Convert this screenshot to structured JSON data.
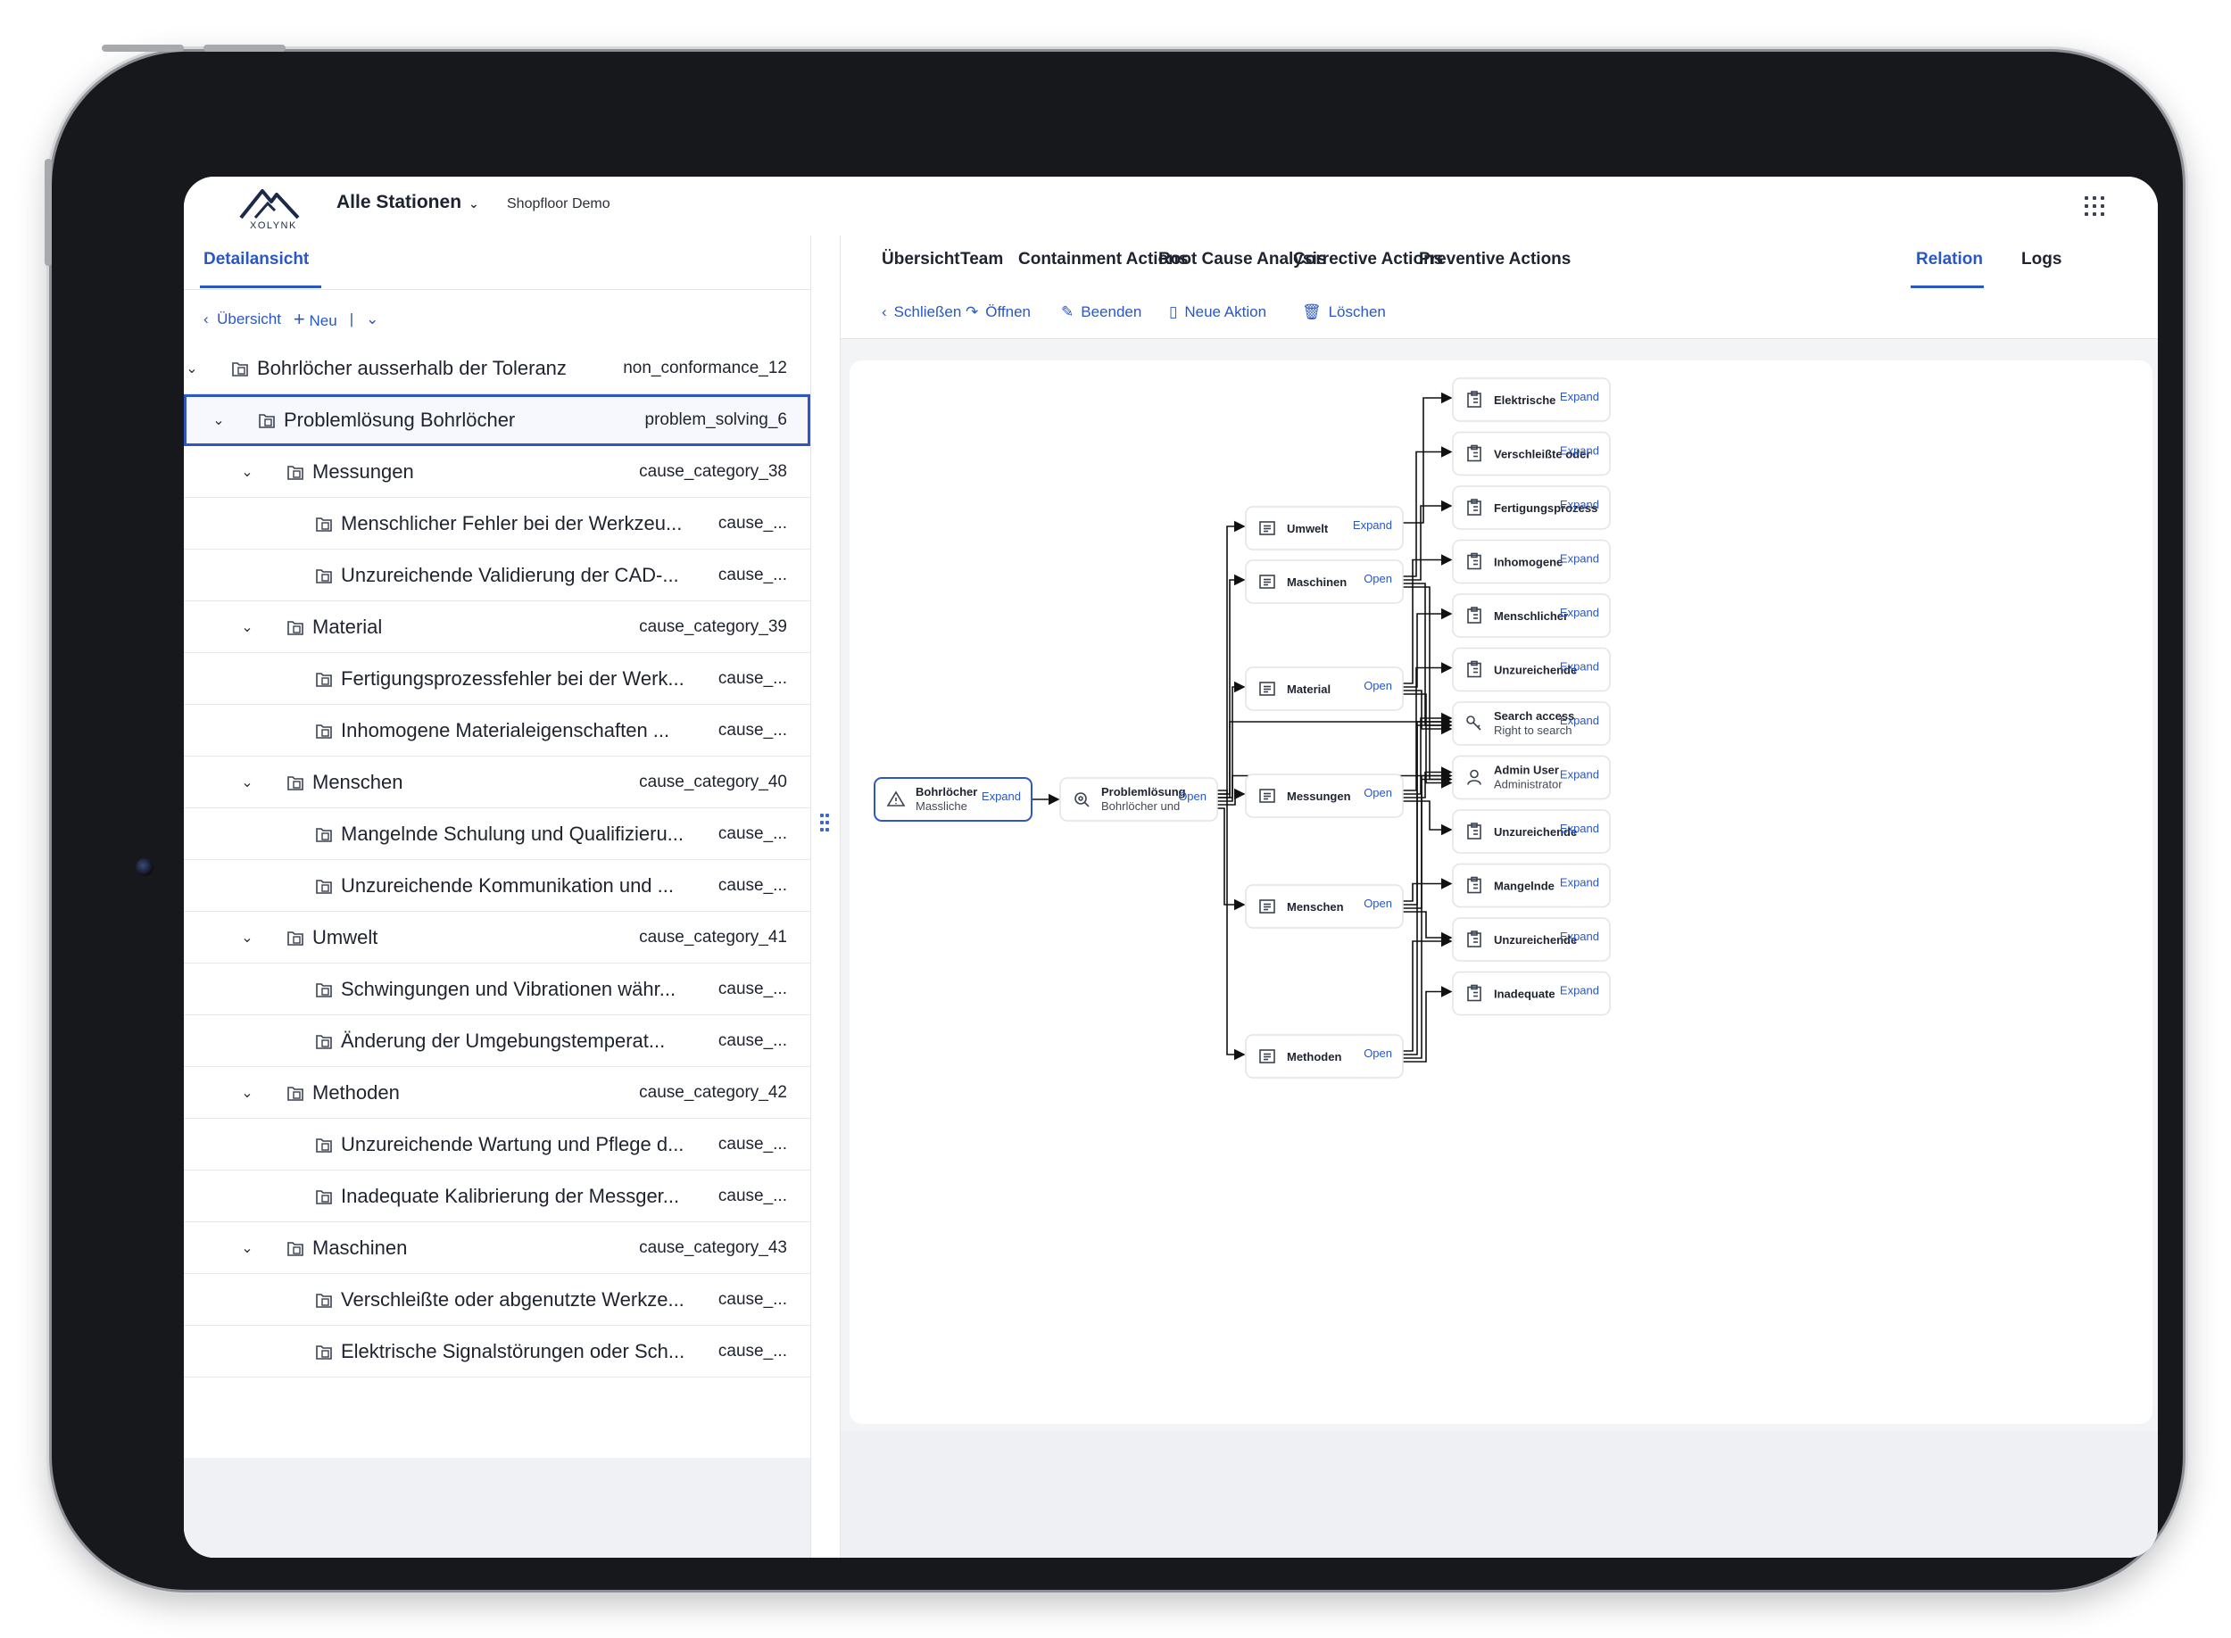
{
  "header": {
    "logo_text": "XOLYNK",
    "station": "Alle Stationen",
    "workspace": "Shopfloor Demo",
    "apps_icon": "grid-icon"
  },
  "left": {
    "tab": "Detailansicht",
    "toolbar": {
      "back": "Übersicht",
      "new": "Neu"
    },
    "tree": [
      {
        "level": 0,
        "expandable": true,
        "name": "Bohrlöcher ausserhalb der Toleranz",
        "id": "non_conformance_12"
      },
      {
        "level": 1,
        "expandable": true,
        "selected": true,
        "name": "Problemlösung Bohrlöcher",
        "id": "problem_solving_6"
      },
      {
        "level": 2,
        "expandable": true,
        "name": "Messungen",
        "id": "cause_category_38"
      },
      {
        "level": 3,
        "expandable": false,
        "name": "Menschlicher Fehler bei der Werkzeu...",
        "id": "cause_..."
      },
      {
        "level": 3,
        "expandable": false,
        "name": "Unzureichende Validierung der CAD-...",
        "id": "cause_..."
      },
      {
        "level": 2,
        "expandable": true,
        "name": "Material",
        "id": "cause_category_39"
      },
      {
        "level": 3,
        "expandable": false,
        "name": "Fertigungsprozessfehler bei der Werk...",
        "id": "cause_..."
      },
      {
        "level": 3,
        "expandable": false,
        "name": "Inhomogene Materialeigenschaften ...",
        "id": "cause_..."
      },
      {
        "level": 2,
        "expandable": true,
        "name": "Menschen",
        "id": "cause_category_40"
      },
      {
        "level": 3,
        "expandable": false,
        "name": "Mangelnde Schulung und Qualifizieru...",
        "id": "cause_..."
      },
      {
        "level": 3,
        "expandable": false,
        "name": "Unzureichende Kommunikation und ...",
        "id": "cause_..."
      },
      {
        "level": 2,
        "expandable": true,
        "name": "Umwelt",
        "id": "cause_category_41"
      },
      {
        "level": 3,
        "expandable": false,
        "name": "Schwingungen und Vibrationen währ...",
        "id": "cause_..."
      },
      {
        "level": 3,
        "expandable": false,
        "name": "Änderung der Umgebungstemperat...",
        "id": "cause_..."
      },
      {
        "level": 2,
        "expandable": true,
        "name": "Methoden",
        "id": "cause_category_42"
      },
      {
        "level": 3,
        "expandable": false,
        "name": "Unzureichende Wartung und Pflege d...",
        "id": "cause_..."
      },
      {
        "level": 3,
        "expandable": false,
        "name": "Inadequate Kalibrierung der Messger...",
        "id": "cause_..."
      },
      {
        "level": 2,
        "expandable": true,
        "name": "Maschinen",
        "id": "cause_category_43"
      },
      {
        "level": 3,
        "expandable": false,
        "name": "Verschleißte oder abgenutzte Werkze...",
        "id": "cause_..."
      },
      {
        "level": 3,
        "expandable": false,
        "name": "Elektrische Signalstörungen oder Sch...",
        "id": "cause_..."
      }
    ]
  },
  "tabs": [
    "Übersicht",
    "Team",
    "Containment Actions",
    "Root Cause Analysis",
    "Corrective Actions",
    "Preventive Actions",
    "Relation",
    "Logs"
  ],
  "active_tab": "Relation",
  "actions": [
    "Schließen",
    "Öffnen",
    "Beenden",
    "Neue Aktion",
    "Löschen"
  ],
  "graph": {
    "nodes": [
      {
        "key": "root",
        "title": "Bohrlöcher",
        "subtitle": "Massliche",
        "action": "Expand",
        "icon": "warning-icon"
      },
      {
        "key": "ps",
        "title": "Problemlösung",
        "subtitle": "Bohrlöcher und",
        "action": "Open",
        "icon": "search-cog-icon"
      },
      {
        "key": "c_umwelt",
        "title": "Umwelt",
        "subtitle": "",
        "action": "Expand",
        "icon": "list-doc-icon"
      },
      {
        "key": "c_maschinen",
        "title": "Maschinen",
        "subtitle": "",
        "action": "Open",
        "icon": "list-doc-icon"
      },
      {
        "key": "c_material",
        "title": "Material",
        "subtitle": "",
        "action": "Open",
        "icon": "list-doc-icon"
      },
      {
        "key": "c_messungen",
        "title": "Messungen",
        "subtitle": "",
        "action": "Open",
        "icon": "list-doc-icon"
      },
      {
        "key": "c_menschen",
        "title": "Menschen",
        "subtitle": "",
        "action": "Open",
        "icon": "list-doc-icon"
      },
      {
        "key": "c_methoden",
        "title": "Methoden",
        "subtitle": "",
        "action": "Open",
        "icon": "list-doc-icon"
      },
      {
        "key": "r1",
        "title": "Elektrische",
        "subtitle": "",
        "action": "Expand",
        "icon": "clipboard-icon"
      },
      {
        "key": "r2",
        "title": "Verschleißte oder",
        "subtitle": "",
        "action": "Expand",
        "icon": "clipboard-icon"
      },
      {
        "key": "r3",
        "title": "Fertigungsprozess",
        "subtitle": "",
        "action": "Expand",
        "icon": "clipboard-icon"
      },
      {
        "key": "r4",
        "title": "Inhomogene",
        "subtitle": "",
        "action": "Expand",
        "icon": "clipboard-icon"
      },
      {
        "key": "r5",
        "title": "Menschlicher",
        "subtitle": "",
        "action": "Expand",
        "icon": "clipboard-icon"
      },
      {
        "key": "r6",
        "title": "Unzureichende",
        "subtitle": "",
        "action": "Expand",
        "icon": "clipboard-icon"
      },
      {
        "key": "r7",
        "title": "Search access",
        "subtitle": "Right to search",
        "action": "Expand",
        "icon": "key-icon"
      },
      {
        "key": "r8",
        "title": "Admin User",
        "subtitle": "Administrator",
        "action": "Expand",
        "icon": "user-icon"
      },
      {
        "key": "r9",
        "title": "Unzureichende",
        "subtitle": "",
        "action": "Expand",
        "icon": "clipboard-icon"
      },
      {
        "key": "r10",
        "title": "Mangelnde",
        "subtitle": "",
        "action": "Expand",
        "icon": "clipboard-icon"
      },
      {
        "key": "r11",
        "title": "Unzureichende",
        "subtitle": "",
        "action": "Expand",
        "icon": "clipboard-icon"
      },
      {
        "key": "r12",
        "title": "Inadequate",
        "subtitle": "",
        "action": "Expand",
        "icon": "clipboard-icon"
      }
    ],
    "edges": [
      [
        "root",
        "ps"
      ],
      [
        "ps",
        "c_umwelt"
      ],
      [
        "ps",
        "c_maschinen"
      ],
      [
        "ps",
        "c_material"
      ],
      [
        "ps",
        "c_messungen"
      ],
      [
        "ps",
        "c_menschen"
      ],
      [
        "ps",
        "c_methoden"
      ],
      [
        "ps",
        "r7"
      ],
      [
        "ps",
        "r8"
      ],
      [
        "c_umwelt",
        "r1"
      ],
      [
        "c_maschinen",
        "r2"
      ],
      [
        "c_maschinen",
        "r3"
      ],
      [
        "c_maschinen",
        "r7"
      ],
      [
        "c_maschinen",
        "r8"
      ],
      [
        "c_material",
        "r4"
      ],
      [
        "c_material",
        "r5"
      ],
      [
        "c_material",
        "r7"
      ],
      [
        "c_material",
        "r8"
      ],
      [
        "c_messungen",
        "r6"
      ],
      [
        "c_messungen",
        "r7"
      ],
      [
        "c_messungen",
        "r8"
      ],
      [
        "c_messungen",
        "r9"
      ],
      [
        "c_menschen",
        "r10"
      ],
      [
        "c_menschen",
        "r7"
      ],
      [
        "c_menschen",
        "r8"
      ],
      [
        "c_menschen",
        "r11"
      ],
      [
        "c_methoden",
        "r11"
      ],
      [
        "c_methoden",
        "r7"
      ],
      [
        "c_methoden",
        "r8"
      ],
      [
        "c_methoden",
        "r12"
      ]
    ]
  },
  "colors": {
    "accent": "#2a56c6",
    "border": "#e1e3e8",
    "panel": "#f3f4f6"
  }
}
